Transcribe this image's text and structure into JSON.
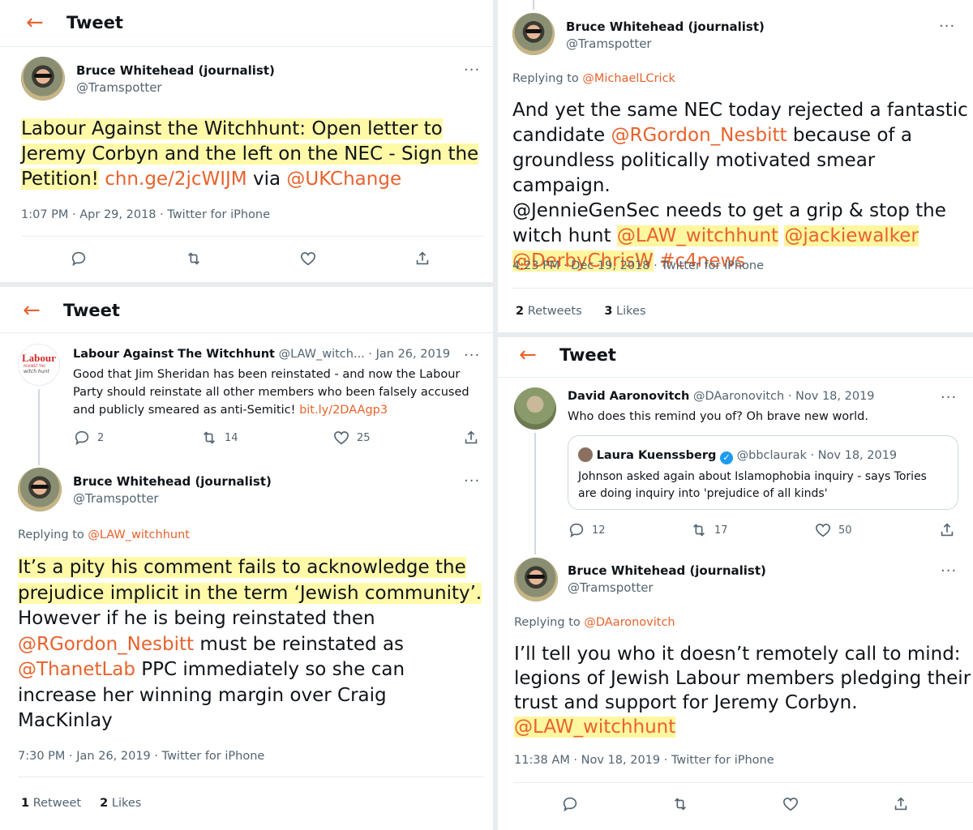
{
  "p1": {
    "header_title": "Tweet",
    "author_name": "Bruce Whitehead (journalist)",
    "author_handle": "@Tramspotter",
    "more": "···",
    "text_hl_1": "Labour Against the Witchhunt: Open letter to",
    "text_hl_2": "Jeremy Corbyn and the left on the NEC - Sign the",
    "text_hl_3": "Petition!",
    "text_link": "chn.ge/2jcWIJM",
    "text_via": "via",
    "text_mention": "@UKChange",
    "meta": "1:07 PM · Apr 29, 2018 · Twitter for iPhone"
  },
  "p2": {
    "author_name": "Bruce Whitehead (journalist)",
    "author_handle": "@Tramspotter",
    "more": "···",
    "replying_prefix": "Replying to",
    "replying_to": "@MichaelLCrick",
    "line1": "And yet the same NEC today rejected a fantastic",
    "line2_mention": "@RGordon_Nesbitt",
    "line2_rest": "because of a",
    "line3": "groundless politically motivated smear campaign.",
    "line4": "@JennieGenSec needs to get a grip & stop the",
    "line5_pre": "witch hunt",
    "line5_m1": "@LAW_witchhunt",
    "line5_m2": "@jackiewalker",
    "line6_m1": "@DerbyChrisW",
    "line6_tag": "#c4news",
    "meta": "4:23 PM · Dec 19, 2018 · Twitter for iPhone",
    "retweets_count": "2",
    "retweets_label": "Retweets",
    "likes_count": "3",
    "likes_label": "Likes"
  },
  "p3": {
    "header_title": "Tweet",
    "law_avatar_text": "Labour",
    "law_avatar_sub": "AGAINST THE",
    "law_avatar_sub2": "witch hunt",
    "parent_name": "Labour Against The Witchhunt",
    "parent_handle": "@LAW_witch...",
    "parent_date": "· Jan 26, 2019",
    "parent_text_1": "Good that Jim Sheridan has been reinstated - and now the Labour",
    "parent_text_2": "Party should reinstate all other members who been falsely accused",
    "parent_text_3": "and publicly smeared as anti-Semitic!",
    "parent_link": "bit.ly/2DAAgp3",
    "parent_replies": "2",
    "parent_retweets": "14",
    "parent_likes": "25",
    "author_name": "Bruce Whitehead (journalist)",
    "author_handle": "@Tramspotter",
    "more": "···",
    "replying_prefix": "Replying to",
    "replying_to": "@LAW_witchhunt",
    "hl_line1": "It’s a pity his comment fails to acknowledge the",
    "hl_line2": "prejudice implicit in the term ‘Jewish community’.",
    "line3": "However if he is being reinstated then",
    "line4_mention": "@RGordon_Nesbitt",
    "line4_rest": "must be reinstated as",
    "line5_mention": "@ThanetLab",
    "line5_rest": "PPC immediately so she can",
    "line6": "increase her winning margin over Craig",
    "line7": "MacKinlay",
    "meta": "7:30 PM · Jan 26, 2019 · Twitter for iPhone",
    "retweets_count": "1",
    "retweets_label": "Retweet",
    "likes_count": "2",
    "likes_label": "Likes"
  },
  "p4": {
    "header_title": "Tweet",
    "parent_name": "David Aaronovitch",
    "parent_handle": "@DAaronovitch · Nov 18, 2019",
    "parent_text": "Who does this remind you of? Oh brave new world.",
    "quote_name": "Laura Kuenssberg",
    "quote_handle": "@bbclaurak · Nov 18, 2019",
    "quote_text_1": "Johnson asked again about Islamophobia inquiry -  says Tories",
    "quote_text_2": "are doing inquiry into 'prejudice of all kinds'",
    "parent_replies": "12",
    "parent_retweets": "17",
    "parent_likes": "50",
    "author_name": "Bruce Whitehead (journalist)",
    "author_handle": "@Tramspotter",
    "more": "···",
    "replying_prefix": "Replying to",
    "replying_to": "@DAaronovitch",
    "line1": "I’ll tell you who it doesn’t remotely call to mind:",
    "line2": "legions of Jewish Labour members pledging their",
    "line3": "trust and support for Jeremy Corbyn.",
    "line4_mention": "@LAW_witchhunt",
    "meta": "11:38 AM · Nov 18, 2019 · Twitter for iPhone"
  },
  "icons": [
    "back-arrow-icon",
    "reply-icon",
    "retweet-icon",
    "like-icon",
    "share-icon",
    "more-icon",
    "verified-icon"
  ],
  "colors": {
    "accent": "#e8622c",
    "highlight": "#fff9a8",
    "muted": "#536471",
    "verified": "#1d9bf0"
  }
}
